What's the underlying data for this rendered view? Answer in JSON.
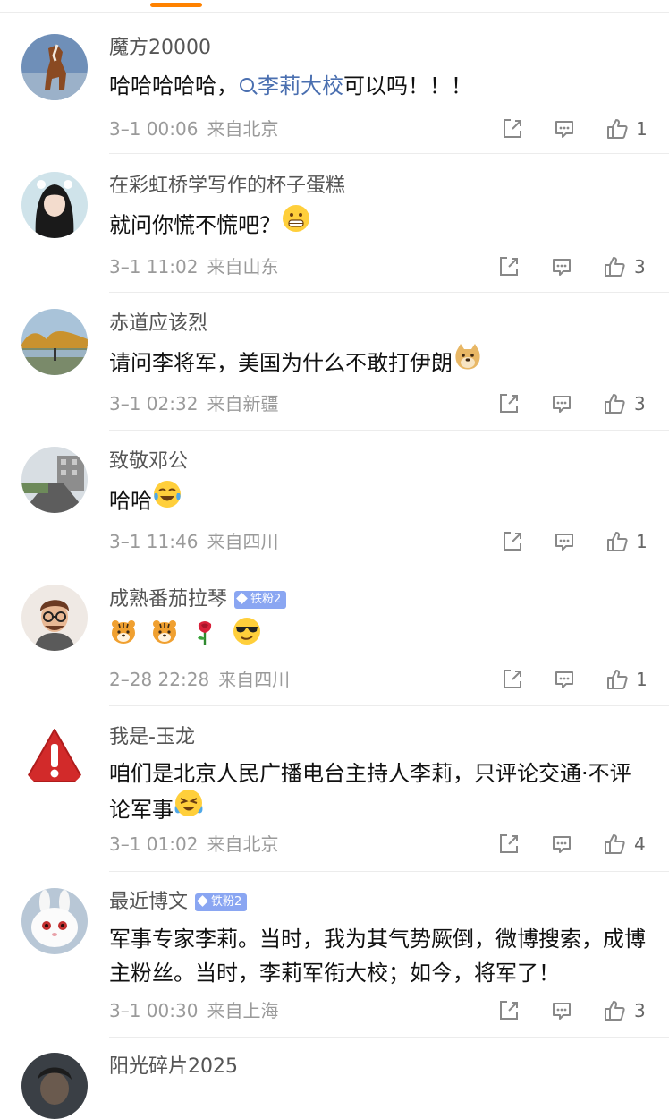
{
  "colors": {
    "accent": "#ff8200",
    "topic": "#4a6fb0",
    "badge": "#8aa6f2",
    "meta": "#9a9a9a"
  },
  "comments": [
    {
      "username": "魔方20000",
      "text_before": "哈哈哈哈哈，",
      "topic": "李莉大校",
      "text_after": "可以吗！！！",
      "time": "3–1 00:06",
      "location": "来自北京",
      "likes": "1",
      "avatar_icon": "horse-avatar"
    },
    {
      "username": "在彩虹桥学写作的杯子蛋糕",
      "text": "就问你慌不慌吧？",
      "emojis": [
        "grin-emoji"
      ],
      "time": "3–1 11:02",
      "location": "来自山东",
      "likes": "3",
      "avatar_icon": "anime-girl-avatar"
    },
    {
      "username": "赤道应该烈",
      "text": "请问李将军，美国为什么不敢打伊朗",
      "emojis": [
        "doge-emoji"
      ],
      "time": "3–1 02:32",
      "location": "来自新疆",
      "likes": "3",
      "avatar_icon": "lakeside-trees-avatar"
    },
    {
      "username": "致敬邓公",
      "text": "哈哈",
      "emojis": [
        "tears-of-joy-emoji"
      ],
      "time": "3–1 11:46",
      "location": "来自四川",
      "likes": "1",
      "avatar_icon": "street-avatar"
    },
    {
      "username": "成熟番茄拉琴",
      "badge": "铁粉2",
      "text": "",
      "emojis": [
        "tiger-emoji",
        "tiger-emoji",
        "rose-emoji",
        "sunglasses-emoji"
      ],
      "time": "2–28 22:28",
      "location": "来自四川",
      "likes": "1",
      "avatar_icon": "cartoon-man-avatar"
    },
    {
      "username": "我是-玉龙",
      "text": "咱们是北京人民广播电台主持人李莉，只评论交通·不评论军事",
      "emojis": [
        "cry-laugh-emoji"
      ],
      "time": "3–1 01:02",
      "location": "来自北京",
      "likes": "4",
      "avatar_icon": "warning-avatar"
    },
    {
      "username": "最近博文",
      "badge": "铁粉2",
      "text": "军事专家李莉。当时，我为其气势厥倒，微博搜索，成博主粉丝。当时，李莉军衔大校；如今，将军了！",
      "time": "3–1 00:30",
      "location": "来自上海",
      "likes": "3",
      "avatar_icon": "white-rabbit-avatar"
    },
    {
      "username": "阳光碎片2025",
      "avatar_icon": "dark-avatar"
    }
  ]
}
